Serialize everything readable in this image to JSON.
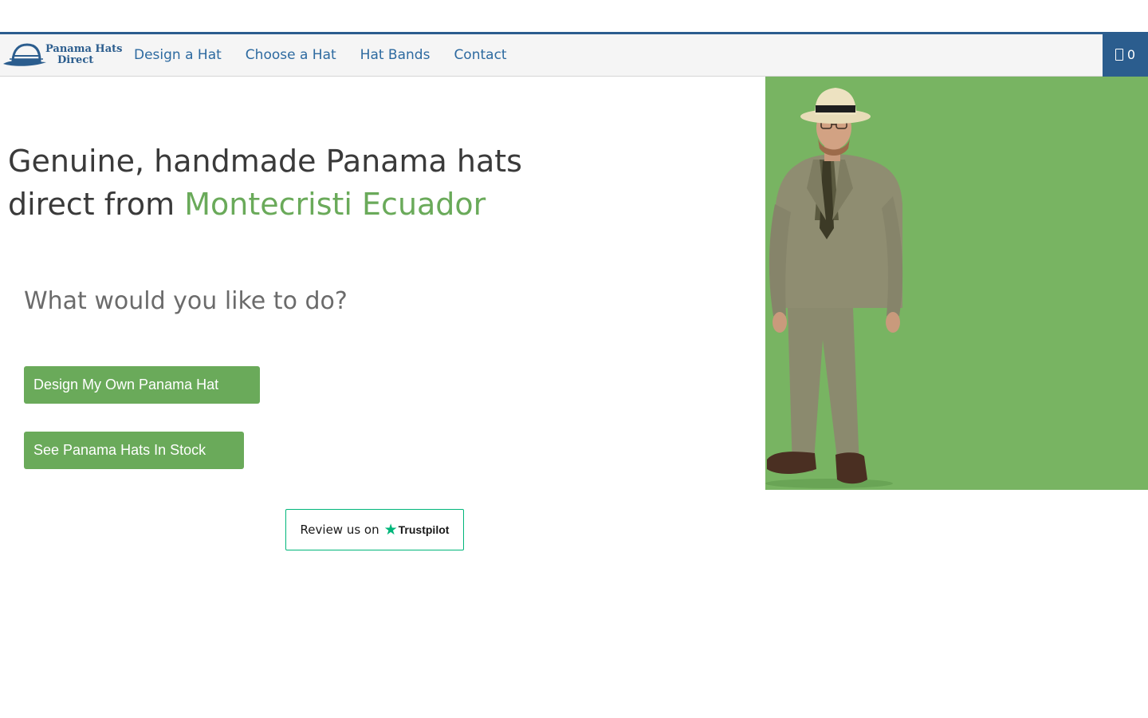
{
  "brand": {
    "logo_line1": "Panama Hats",
    "logo_line2": "Direct"
  },
  "nav": {
    "items": [
      {
        "label": "Design a Hat"
      },
      {
        "label": "Choose a Hat"
      },
      {
        "label": "Hat Bands"
      },
      {
        "label": "Contact"
      }
    ],
    "cart_count": "0"
  },
  "hero": {
    "headline_part1": "Genuine, handmade Panama hats direct from ",
    "headline_accent": "Montecristi Ecuador",
    "question": "What would you like to do?",
    "primary_button": "Design My Own Panama Hat",
    "secondary_button": "See Panama Hats In Stock"
  },
  "trustpilot": {
    "text": "Review us on",
    "brand": "Trustpilot"
  },
  "photo": {
    "icon": "man-in-panama-hat-and-suit"
  },
  "colors": {
    "brand_blue": "#2b5d8e",
    "link_blue": "#2d6aa0",
    "accent_green": "#6aaa5a",
    "photo_bg_green": "#78b462",
    "trustpilot_green": "#00b67a"
  }
}
